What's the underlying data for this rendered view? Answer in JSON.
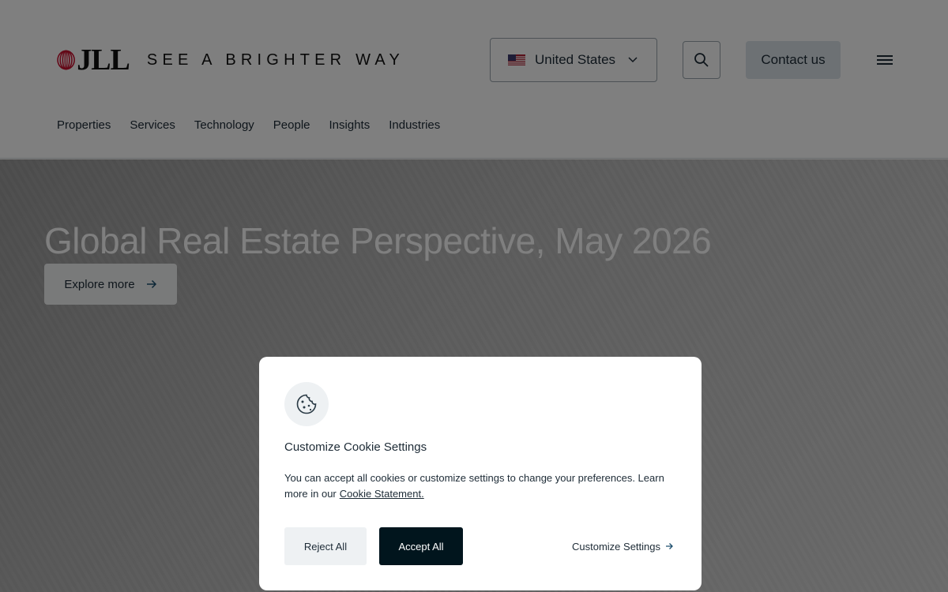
{
  "header": {
    "logo_text": "JLL",
    "tagline": "SEE A BRIGHTER WAY",
    "country": {
      "label": "United States",
      "flag": "us-flag-icon"
    },
    "search": {
      "icon": "search-icon"
    },
    "contact_label": "Contact us",
    "menu": {
      "icon": "hamburger-menu-icon"
    },
    "nav": [
      {
        "label": "Properties"
      },
      {
        "label": "Services"
      },
      {
        "label": "Technology"
      },
      {
        "label": "People"
      },
      {
        "label": "Insights"
      },
      {
        "label": "Industries"
      }
    ]
  },
  "hero": {
    "title": "Global Real Estate Perspective, May 2026",
    "button_label": "Explore more"
  },
  "cookie_modal": {
    "icon": "cookie-icon",
    "title": "Customize Cookie Settings",
    "text": "You can accept all cookies or customize settings to change your preferences. Learn more in our",
    "link_label": "Cookie Statement.",
    "reject_label": "Reject All",
    "accept_label": "Accept All",
    "customize_label": "Customize Settings"
  },
  "colors": {
    "brand_red": "#c8102e",
    "accept_bg": "#01151d",
    "contact_bg": "#dbe3e8",
    "text": "#1d2b36"
  }
}
